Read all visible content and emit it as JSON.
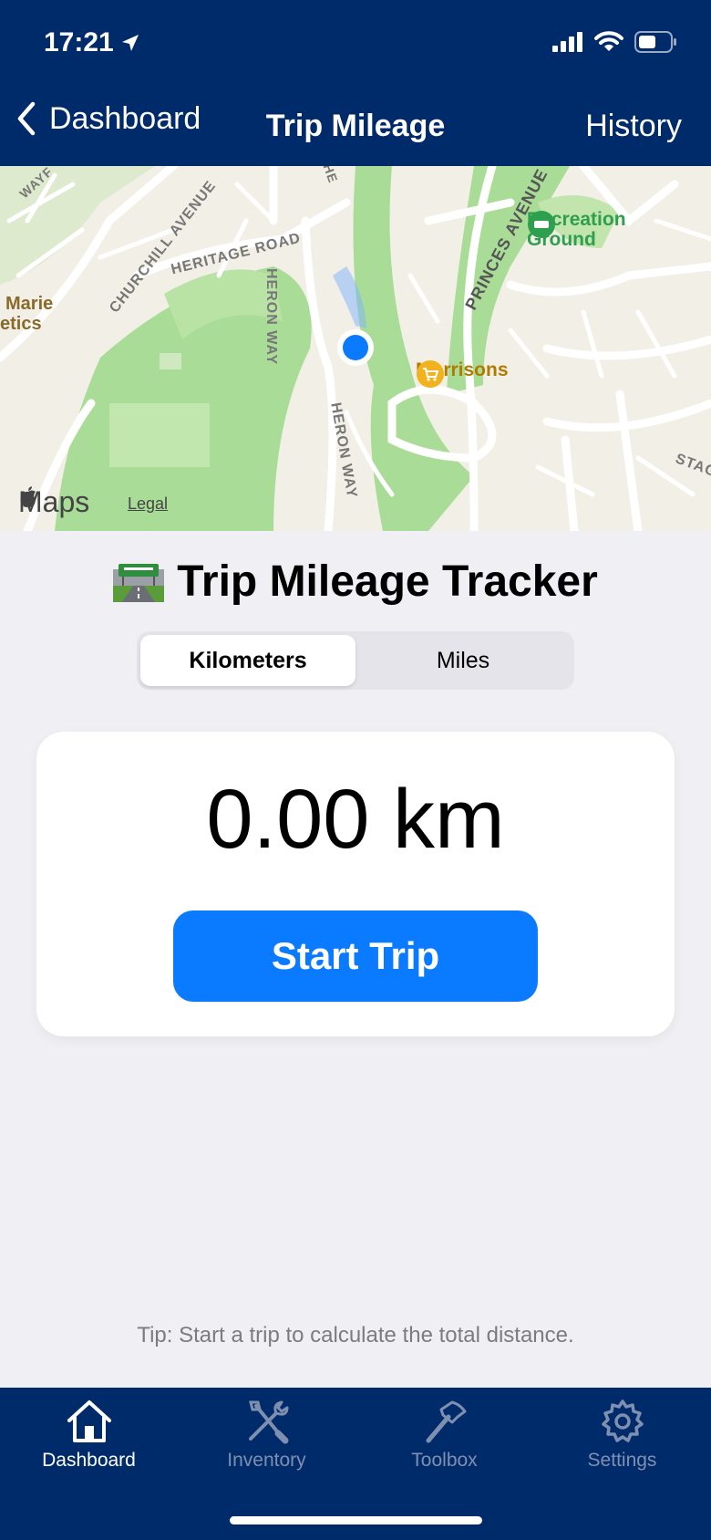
{
  "status_bar": {
    "time": "17:21"
  },
  "nav": {
    "back_label": "Dashboard",
    "title": "Trip Mileage",
    "right_label": "History"
  },
  "map": {
    "streets": [
      "CHURCHILL AVENUE",
      "HERITAGE ROAD",
      "HERON WAY",
      "HERON WAY",
      "PRINCES AVENUE",
      "WAYF",
      "STAG",
      "HE"
    ],
    "pois": [
      {
        "name_line1": "Recreation",
        "name_line2": "Ground",
        "icon": "park-icon",
        "color": "#2e9e4f"
      },
      {
        "name_line1": "Morrisons",
        "icon": "shopping-cart-icon",
        "color": "#c68a00"
      },
      {
        "name_line1": "Marie",
        "name_line2": "etics",
        "color": "#8a6a2a"
      }
    ],
    "brand": "Maps",
    "legal": "Legal"
  },
  "main": {
    "title_icon": "motorway-icon",
    "title": "Trip Mileage Tracker",
    "units": {
      "options": [
        "Kilometers",
        "Miles"
      ],
      "selected": "Kilometers"
    },
    "distance": "0.00 km",
    "start_button": "Start Trip",
    "tip": "Tip: Start a trip to calculate the total distance."
  },
  "tabbar": {
    "items": [
      {
        "label": "Dashboard",
        "icon": "house-icon",
        "active": true
      },
      {
        "label": "Inventory",
        "icon": "tools-icon",
        "active": false
      },
      {
        "label": "Toolbox",
        "icon": "hammer-icon",
        "active": false
      },
      {
        "label": "Settings",
        "icon": "gear-icon",
        "active": false
      }
    ]
  },
  "colors": {
    "header_bg": "#002b6b",
    "accent": "#0a7aff",
    "page_bg": "#efeff4"
  }
}
